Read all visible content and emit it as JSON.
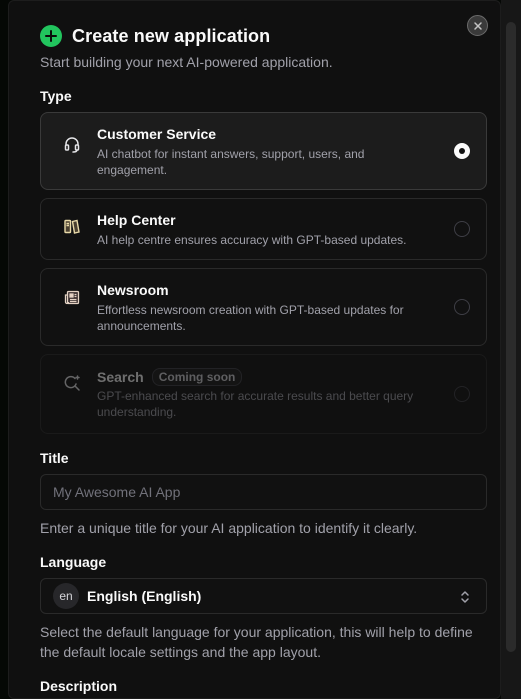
{
  "dialog": {
    "title": "Create new application",
    "subtitle": "Start building your next AI-powered application."
  },
  "type_section": {
    "label": "Type",
    "options": [
      {
        "title": "Customer Service",
        "description": "AI chatbot for instant answers, support, users, and engagement.",
        "icon": "headset-icon",
        "selected": true,
        "badge": ""
      },
      {
        "title": "Help Center",
        "description": "AI help centre ensures accuracy with GPT-based updates.",
        "icon": "book-icon",
        "selected": false,
        "badge": ""
      },
      {
        "title": "Newsroom",
        "description": "Effortless newsroom creation with GPT-based updates for announcements.",
        "icon": "newspaper-icon",
        "selected": false,
        "badge": ""
      },
      {
        "title": "Search",
        "description": "GPT-enhanced search for accurate results and better query understanding.",
        "icon": "search-sparkle-icon",
        "selected": false,
        "badge": "Coming soon"
      }
    ]
  },
  "title_field": {
    "label": "Title",
    "placeholder": "My Awesome AI App",
    "value": "",
    "help": "Enter a unique title for your AI application to identify it clearly."
  },
  "language_field": {
    "label": "Language",
    "code": "en",
    "value": "English (English)",
    "help": "Select the default language for your application, this will help to define the default locale settings and the app layout."
  },
  "description_field": {
    "label": "Description"
  },
  "colors": {
    "accent": "#22c55e",
    "background": "#101010",
    "card_border": "#2a2a2a",
    "muted_text": "#a1a1aa"
  }
}
